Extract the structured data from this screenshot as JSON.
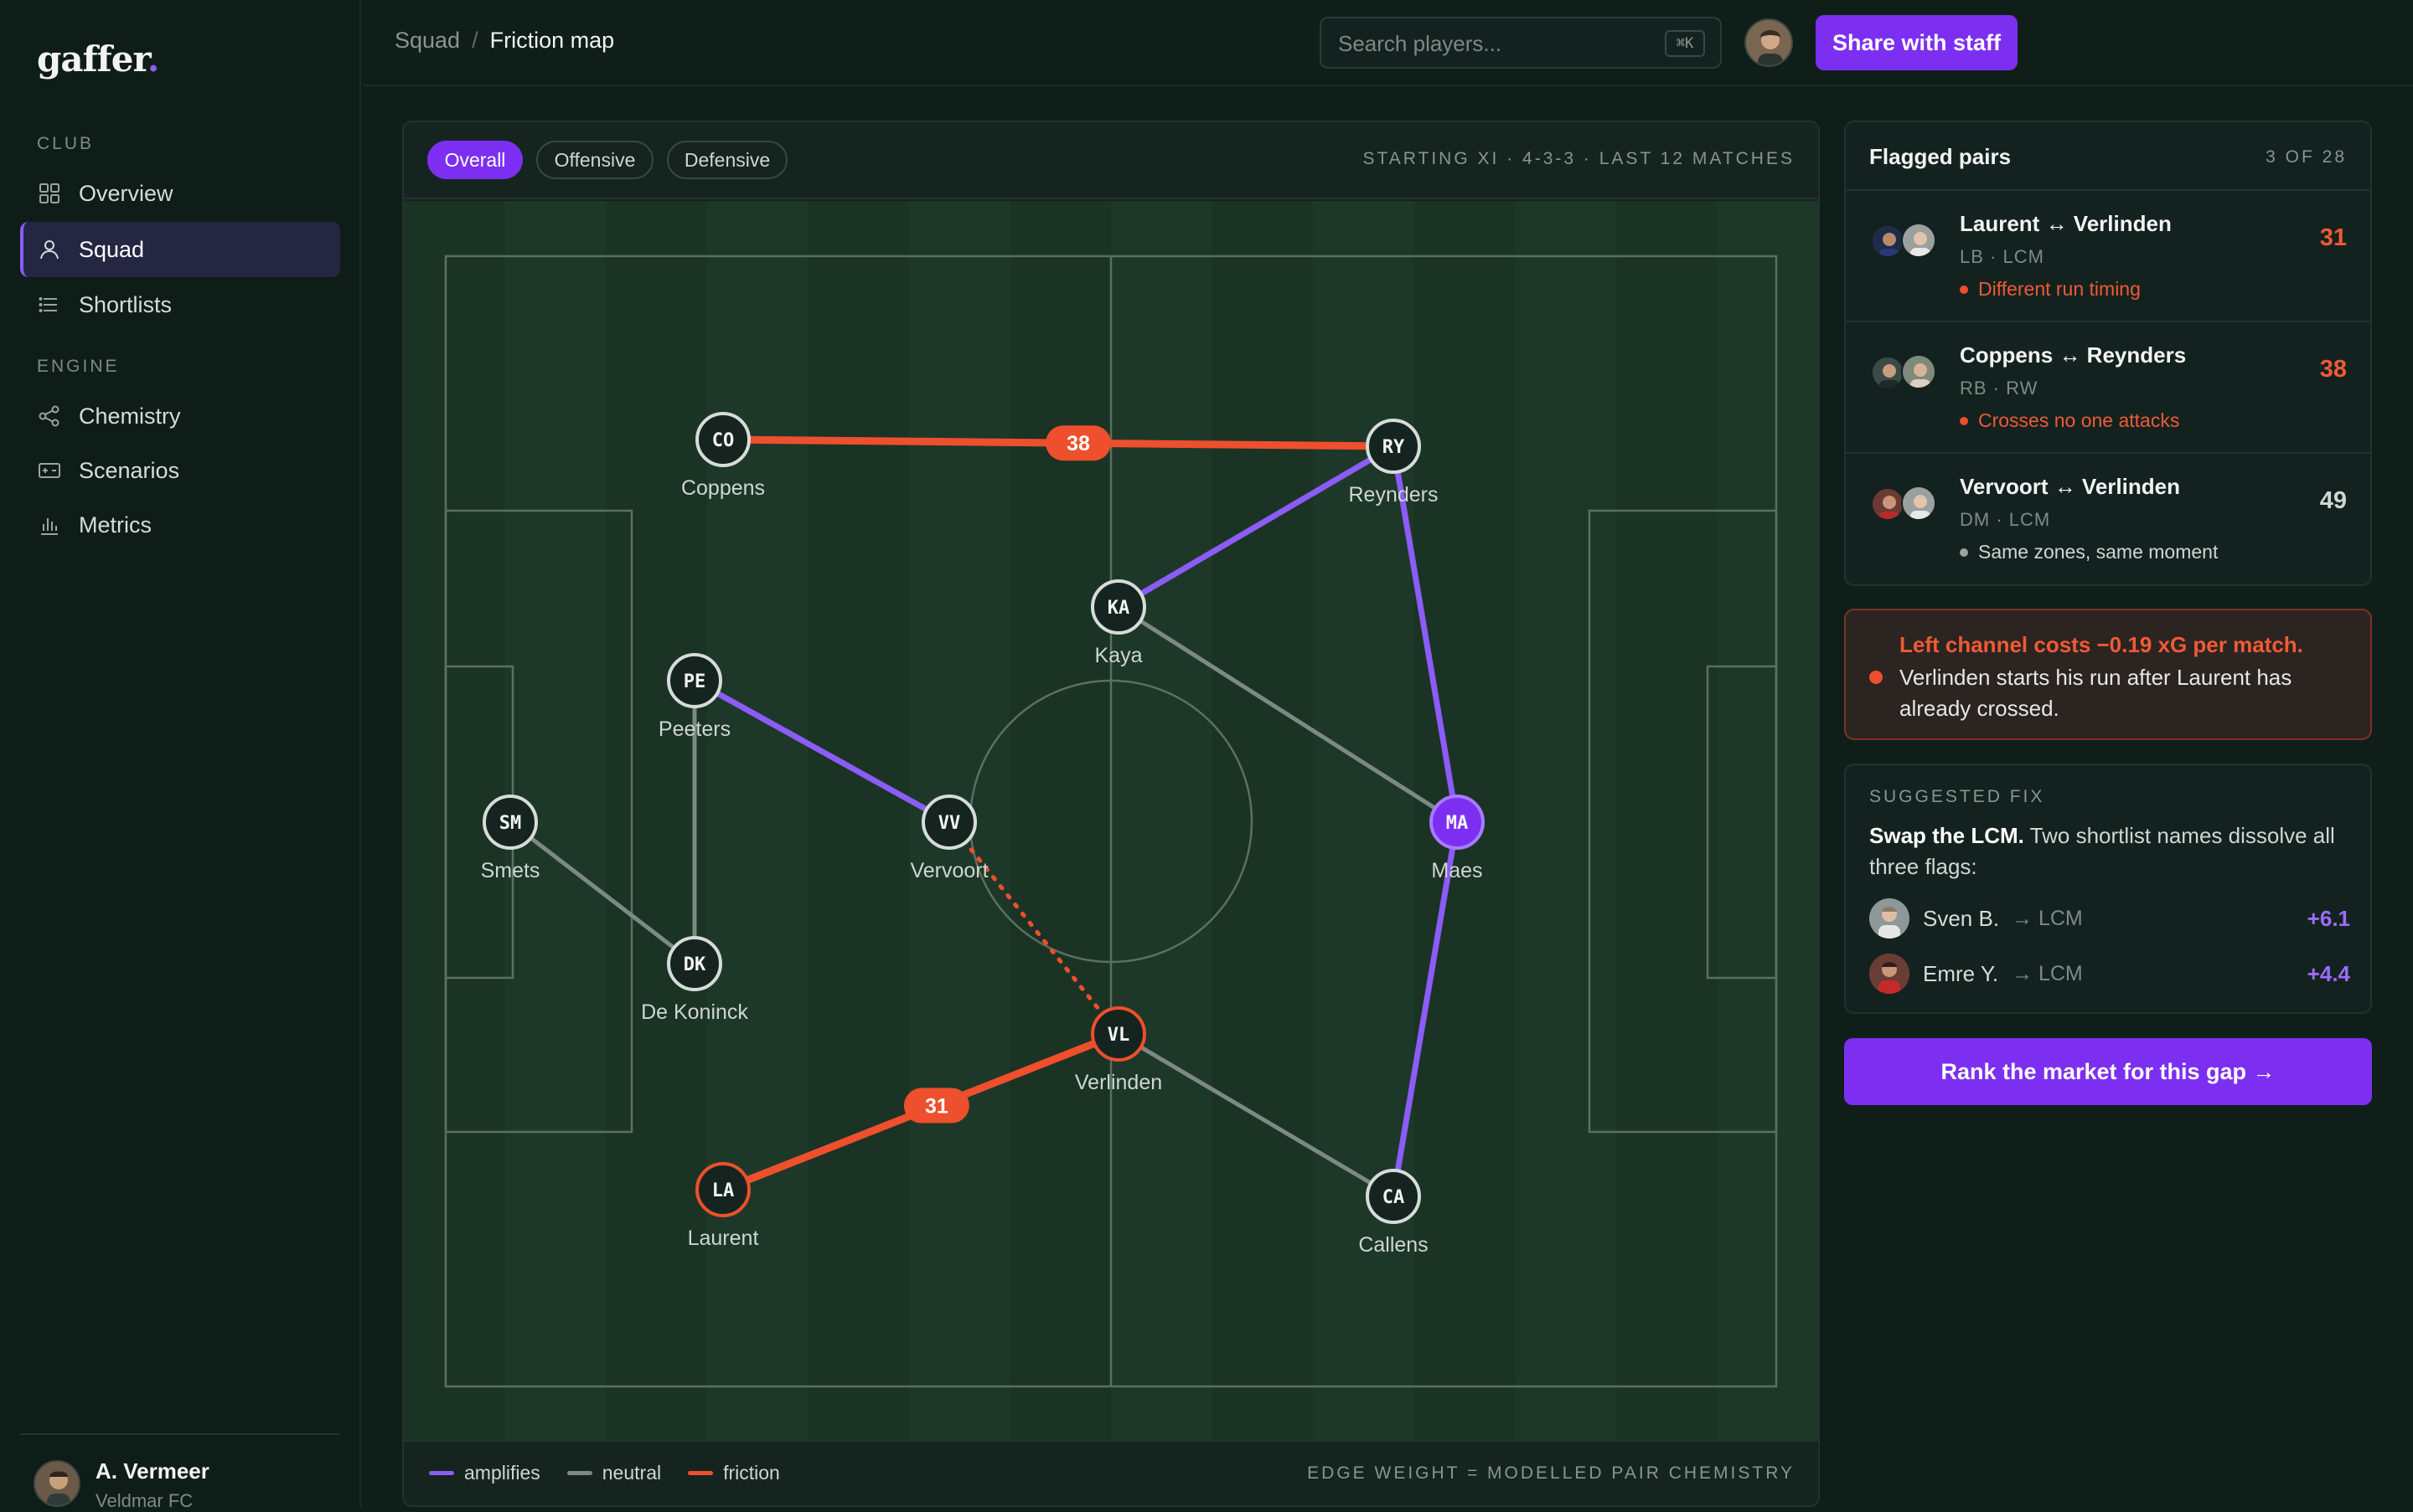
{
  "app": {
    "logo_text": "gaffer",
    "logo_dot": "."
  },
  "sidebar": {
    "sections": [
      {
        "label": "CLUB",
        "items": [
          {
            "label": "Overview",
            "icon": "grid-icon",
            "active": false
          },
          {
            "label": "Squad",
            "icon": "person-icon",
            "active": true
          },
          {
            "label": "Shortlists",
            "icon": "list-icon",
            "active": false
          }
        ]
      },
      {
        "label": "ENGINE",
        "items": [
          {
            "label": "Chemistry",
            "icon": "share-nodes-icon",
            "active": false
          },
          {
            "label": "Scenarios",
            "icon": "ticket-icon",
            "active": false
          },
          {
            "label": "Metrics",
            "icon": "bar-chart-icon",
            "active": false
          }
        ]
      }
    ],
    "user": {
      "name": "A. Vermeer",
      "club": "Veldmar FC"
    }
  },
  "topbar": {
    "breadcrumb": [
      "Squad",
      "Friction map"
    ],
    "breadcrumb_sep": "/",
    "search_placeholder": "Search players...",
    "search_shortcut": "⌘K",
    "share_label": "Share with staff"
  },
  "pitch_card": {
    "tabs": [
      {
        "label": "Overall",
        "active": true
      },
      {
        "label": "Offensive",
        "active": false
      },
      {
        "label": "Defensive",
        "active": false
      }
    ],
    "meta": "STARTING XI · 4-3-3 · LAST 12 MATCHES",
    "legend": [
      {
        "label": "amplifies",
        "color": "#8b5cf6"
      },
      {
        "label": "neutral",
        "color": "#7d8985"
      },
      {
        "label": "friction",
        "color": "#ee4f2c"
      }
    ],
    "footnote": "EDGE WEIGHT = MODELLED PAIR CHEMISTRY"
  },
  "colors": {
    "accent": "#7c2ff0",
    "amplify": "#8b5cf6",
    "neutral": "#7d8985",
    "friction": "#ee4f2c",
    "pitch": "#1a3324",
    "pitch_alt": "#1d3828"
  },
  "players": [
    {
      "id": "CO",
      "name": "Coppens",
      "status": "normal"
    },
    {
      "id": "RY",
      "name": "Reynders",
      "status": "normal"
    },
    {
      "id": "KA",
      "name": "Kaya",
      "status": "normal"
    },
    {
      "id": "PE",
      "name": "Peeters",
      "status": "normal"
    },
    {
      "id": "SM",
      "name": "Smets",
      "status": "normal"
    },
    {
      "id": "VV",
      "name": "Vervoort",
      "status": "normal"
    },
    {
      "id": "MA",
      "name": "Maes",
      "status": "highlight"
    },
    {
      "id": "DK",
      "name": "De Koninck",
      "status": "normal"
    },
    {
      "id": "VL",
      "name": "Verlinden",
      "status": "friction"
    },
    {
      "id": "LA",
      "name": "Laurent",
      "status": "friction"
    },
    {
      "id": "CA",
      "name": "Callens",
      "status": "normal"
    }
  ],
  "links": [
    {
      "from": "CO",
      "to": "RY",
      "type": "friction",
      "score": "38"
    },
    {
      "from": "LA",
      "to": "VL",
      "type": "friction",
      "score": "31"
    },
    {
      "from": "VV",
      "to": "VL",
      "type": "friction-dotted",
      "score": ""
    },
    {
      "from": "KA",
      "to": "RY",
      "type": "amplifies",
      "score": ""
    },
    {
      "from": "RY",
      "to": "MA",
      "type": "amplifies",
      "score": ""
    },
    {
      "from": "MA",
      "to": "CA",
      "type": "amplifies",
      "score": ""
    },
    {
      "from": "PE",
      "to": "VV",
      "type": "amplifies",
      "score": ""
    },
    {
      "from": "KA",
      "to": "MA",
      "type": "neutral",
      "score": ""
    },
    {
      "from": "PE",
      "to": "DK",
      "type": "neutral",
      "score": ""
    },
    {
      "from": "SM",
      "to": "DK",
      "type": "neutral",
      "score": ""
    },
    {
      "from": "VL",
      "to": "CA",
      "type": "neutral",
      "score": ""
    }
  ],
  "flagged": {
    "title": "Flagged pairs",
    "count": "3 OF 28",
    "pairs": [
      {
        "names": "Laurent ↔ Verlinden",
        "positions": "LB · LCM",
        "reason": "Different run timing",
        "score": "31",
        "severity": "friction"
      },
      {
        "names": "Coppens ↔ Reynders",
        "positions": "RB · RW",
        "reason": "Crosses no one attacks",
        "score": "38",
        "severity": "friction"
      },
      {
        "names": "Vervoort ↔ Verlinden",
        "positions": "DM · LCM",
        "reason": "Same zones, same moment",
        "score": "49",
        "severity": "neutral"
      }
    ]
  },
  "alert": {
    "title": "Left channel costs −0.19 xG per match.",
    "body": "Verlinden starts his run after Laurent has already crossed."
  },
  "fix": {
    "label": "SUGGESTED FIX",
    "title": "Swap the LCM.",
    "body": "Two shortlist names dissolve all three flags:",
    "candidates": [
      {
        "name": "Sven B.",
        "role": "→ LCM",
        "delta": "+6.1"
      },
      {
        "name": "Emre Y.",
        "role": "→ LCM",
        "delta": "+4.4"
      }
    ]
  },
  "cta_label": "Rank the market for this gap →"
}
